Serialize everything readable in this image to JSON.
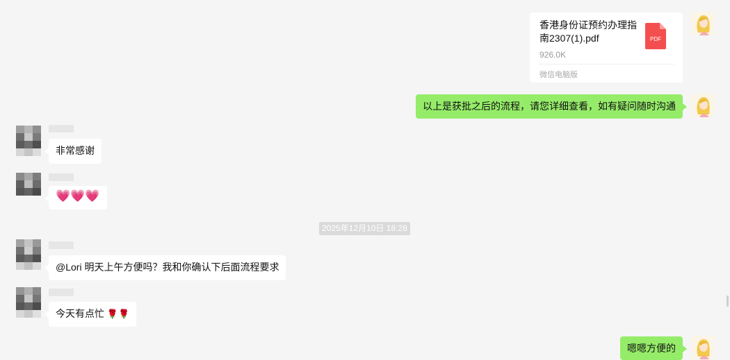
{
  "file": {
    "name": "香港身份证预约办理指南2307(1).pdf",
    "size": "926.0K",
    "source": "微信电脑版",
    "icon": "pdf-file-icon",
    "icon_text": "PDF",
    "color": "#f44f4f"
  },
  "messages": {
    "m1": "以上是获批之后的流程，请您详细查看，如有疑问随时沟通",
    "m2": "非常感谢",
    "m3_hearts": "💗💗💗",
    "m4": "@Lori 明天上午方便吗？我和你确认下后面流程要求",
    "m5_text": "今天有点忙",
    "m5_roses": "🌹🌹",
    "m6": "嗯嗯方便的"
  },
  "timestamp": "2025年12月10日 18:28",
  "colors": {
    "background": "#f5f5f5",
    "outgoing_bubble": "#95ec69",
    "incoming_bubble": "#ffffff"
  }
}
